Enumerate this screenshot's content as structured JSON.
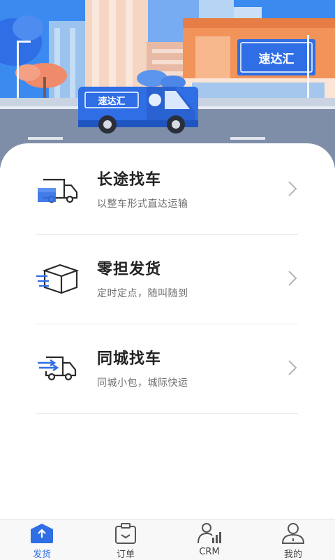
{
  "theme": {
    "accent": "#2f6ee5",
    "banner_sky": "#3a8af0"
  },
  "banner": {
    "van_brand": "速达汇",
    "store_sign": "速达汇"
  },
  "services": [
    {
      "title": "长途找车",
      "subtitle": "以整车形式直达运输",
      "icon": "long-haul-truck-icon"
    },
    {
      "title": "零担发货",
      "subtitle": "定时定点，随叫随到",
      "icon": "parcel-box-icon"
    },
    {
      "title": "同城找车",
      "subtitle": "同城小包，城际快运",
      "icon": "fast-delivery-truck-icon"
    }
  ],
  "tabbar": {
    "active": "发货",
    "items": [
      {
        "label": "发货",
        "icon": "ship-upload-icon"
      },
      {
        "label": "订单",
        "icon": "order-clipboard-icon"
      },
      {
        "label": "CRM",
        "icon": "crm-user-stats-icon"
      },
      {
        "label": "我的",
        "icon": "profile-icon"
      }
    ]
  }
}
